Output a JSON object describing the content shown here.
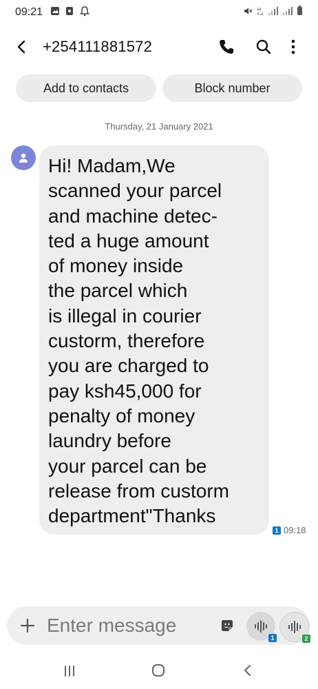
{
  "status_bar": {
    "time": "09:21",
    "left_icons": [
      "gallery-icon",
      "sd-card-icon",
      "notification-bell-icon"
    ],
    "right_icons": [
      "mute-icon",
      "network-h-icon",
      "signal-icon",
      "signal-icon",
      "battery-icon"
    ]
  },
  "header": {
    "contact_number": "+254111881572",
    "icons": [
      "back-icon",
      "phone-icon",
      "search-icon",
      "more-icon"
    ]
  },
  "actions": {
    "add_contacts": "Add to contacts",
    "block_number": "Block number"
  },
  "conversation": {
    "date": "Thursday, 21 January 2021",
    "messages": [
      {
        "text": "Hi! Madam,We\nscanned your parcel\nand machine detec-\nted a huge amount\nof money inside\nthe parcel which\nis illegal in courier\ncustorm, therefore\nyou are charged to\npay ksh45,000 for\npenalty of money\nlaundry before\nyour parcel can be\nrelease from custorm\ndepartment\"Thanks",
        "sim": "1",
        "time": "09:18"
      }
    ]
  },
  "composer": {
    "placeholder": "Enter message",
    "voice_sim_1": "1",
    "voice_sim_2": "2"
  },
  "colors": {
    "bubble": "#eeeeee",
    "pill": "#ececec",
    "sim1": "#1478c8",
    "sim2": "#2e9d4a",
    "avatar": "#7b86d9"
  }
}
